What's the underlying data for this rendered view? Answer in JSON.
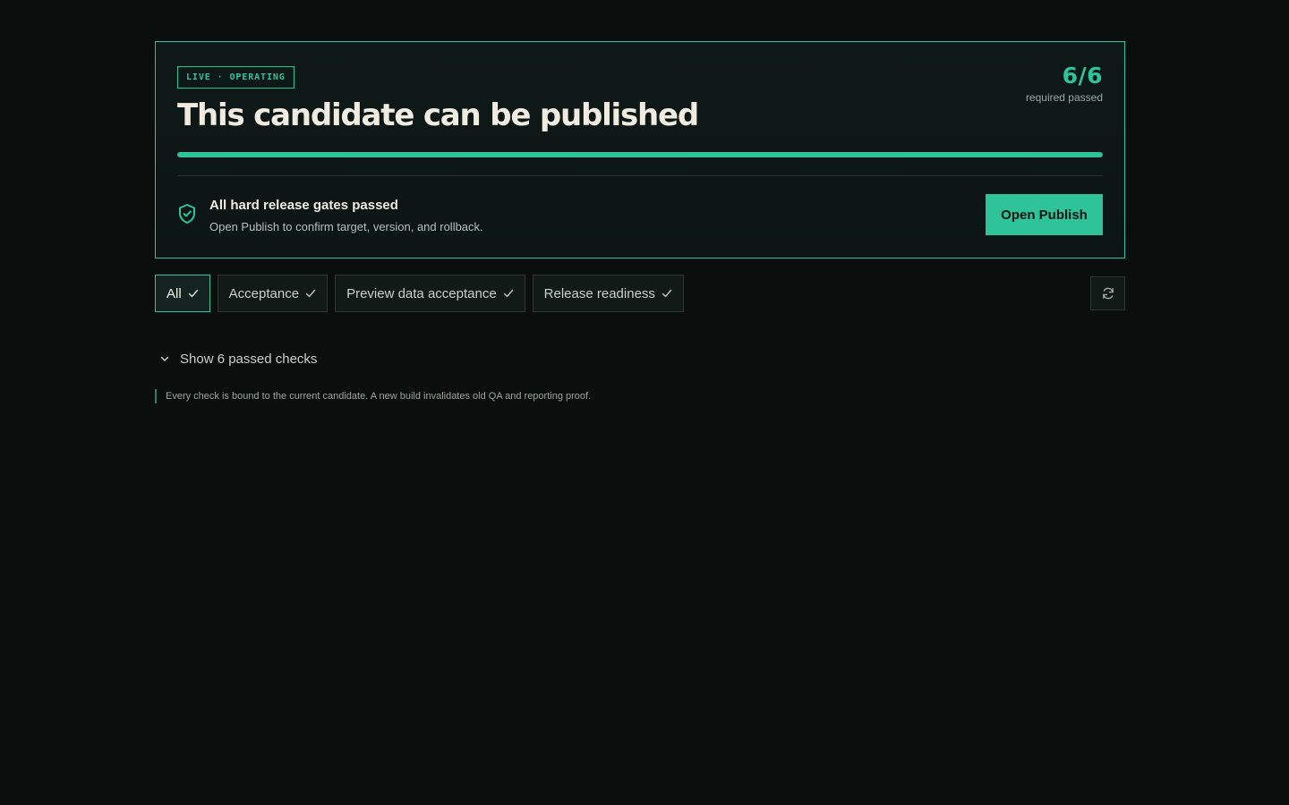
{
  "status": {
    "pill_label": "LIVE · OPERATING",
    "headline": "This candidate can be published",
    "passed_count": "6/6",
    "passed_label": "required passed",
    "progress_fraction": 1.0
  },
  "gate": {
    "icon": "shield-check-icon",
    "title": "All hard release gates passed",
    "description": "Open Publish to confirm target, version, and rollback.",
    "button_label": "Open Publish"
  },
  "filters": {
    "tabs": [
      {
        "label": "All",
        "active": true,
        "icon": "check-icon"
      },
      {
        "label": "Acceptance",
        "active": false,
        "icon": "check-icon"
      },
      {
        "label": "Preview data acceptance",
        "active": false,
        "icon": "check-icon"
      },
      {
        "label": "Release readiness",
        "active": false,
        "icon": "check-icon"
      }
    ],
    "refresh_icon": "refresh-icon"
  },
  "checks": {
    "toggle_label": "Show 6 passed checks",
    "toggle_icon": "chevron-down-icon"
  },
  "footnote": "Every check is bound to the current candidate. A new build invalidates old QA and reporting proof.",
  "colors": {
    "accent": "#2fc39a",
    "background": "#0a0e0d",
    "headline": "#f0ebe0"
  }
}
